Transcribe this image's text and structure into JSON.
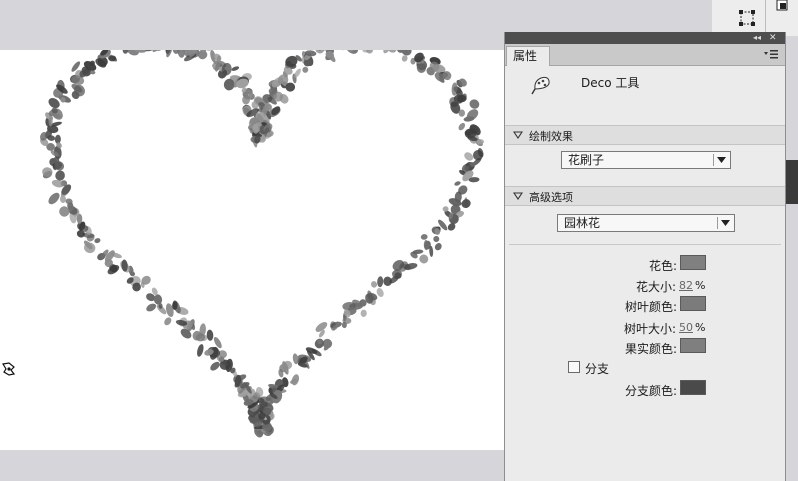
{
  "panel": {
    "tab_label": "属性",
    "tool_name": "Deco 工具",
    "section_draw_label": "绘制效果",
    "brush_value": "花刷子",
    "section_advanced_label": "高级选项",
    "garden_value": "园林花",
    "flower_color_label": "花色:",
    "flower_size_label": "花大小:",
    "flower_size_value": "82",
    "flower_size_unit": "%",
    "leaf_color_label": "树叶颜色:",
    "leaf_size_label": "树叶大小:",
    "leaf_size_value": "50",
    "leaf_size_unit": "%",
    "fruit_color_label": "果实颜色:",
    "branch_label": "分支",
    "branch_checked": false,
    "branch_color_label": "分支颜色:"
  },
  "colors": {
    "flower_color": "#808080",
    "leaf_color": "#7b7b7b",
    "fruit_color": "#7f7f7f",
    "branch_color": "#4a4a4a",
    "stage_bg": "#d6d6da",
    "canvas_bg": "#ffffff",
    "panel_bg": "#ebebeb"
  },
  "icons": {
    "deco_tool": "deco-brush-icon",
    "free_transform": "free-transform-icon",
    "panel_menu": "panel-menu-icon",
    "collapse": "collapse-icon",
    "close": "close-icon",
    "cursor": "deco-cursor-icon"
  },
  "artwork": {
    "shape": "heart",
    "description_visible": "heart-shaped garden flower pattern"
  }
}
